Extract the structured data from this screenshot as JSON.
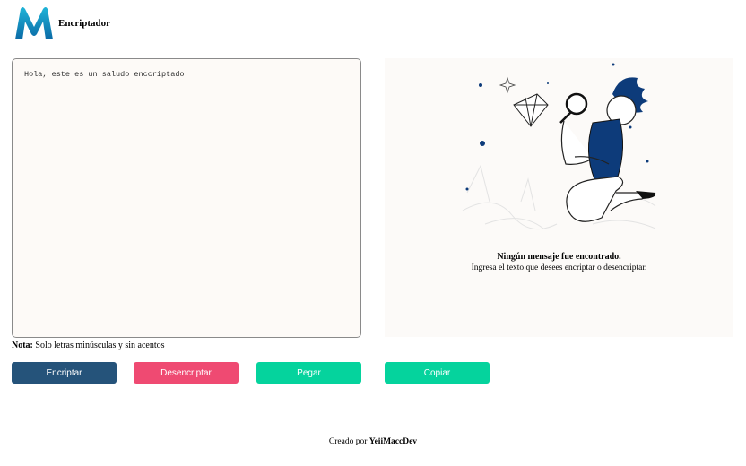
{
  "app": {
    "title": "Encriptador",
    "logo_letter": "M"
  },
  "input": {
    "value": "Hola, este es un saludo enccriptado"
  },
  "note": {
    "label": "Nota:",
    "text": " Solo letras minúsculas y sin acentos"
  },
  "buttons": {
    "encrypt": "Encriptar",
    "decrypt": "Desencriptar",
    "paste": "Pegar",
    "copy": "Copiar"
  },
  "output": {
    "title": "Ningún mensaje fue encontrado.",
    "subtitle": "Ingresa el texto que desees encriptar o desencriptar."
  },
  "footer": {
    "prefix": "Creado por ",
    "author": "YeiiMaccDev"
  },
  "colors": {
    "encrypt": "#25537a",
    "decrypt": "#ef4a72",
    "paste": "#05d39d",
    "copy": "#05d39d",
    "logo_gradient_top": "#1fb4d8",
    "logo_gradient_bottom": "#0b6aa6",
    "illustration_shirt": "#0d3b7a"
  }
}
